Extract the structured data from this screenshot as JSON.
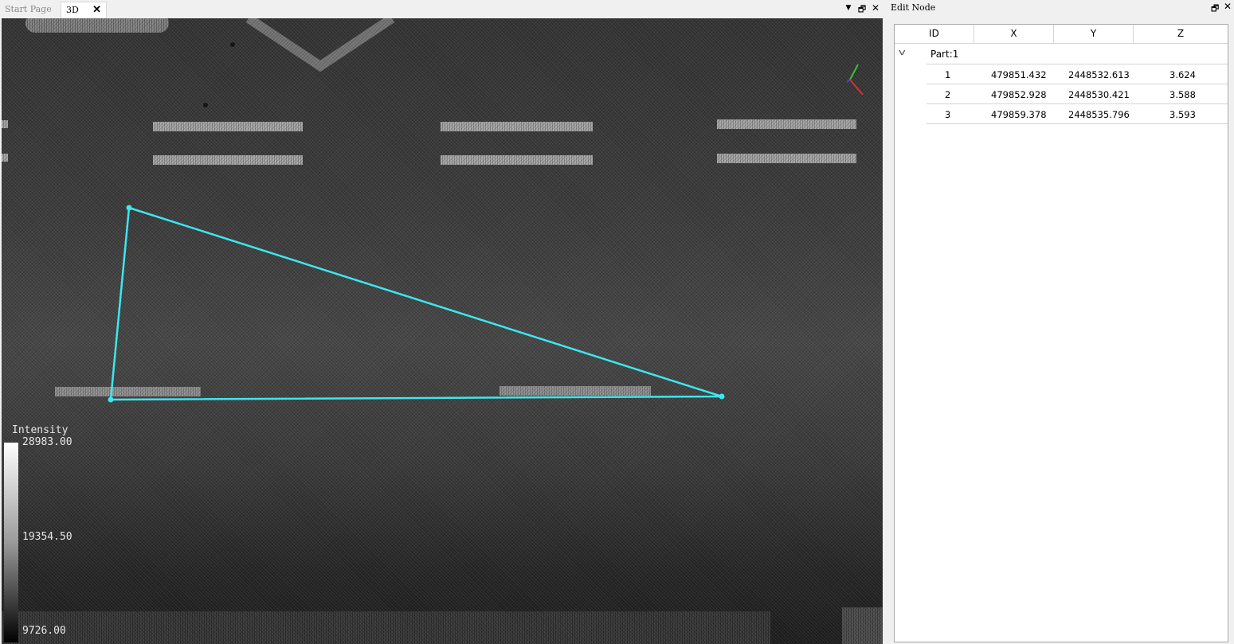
{
  "tabs": [
    {
      "label": "Start Page",
      "active": false
    },
    {
      "label": "3D",
      "active": true
    }
  ],
  "tab_close_glyph": "✕",
  "doc_controls": {
    "dropdown_icon": "chevron-down-icon",
    "restore_icon": "restore-icon",
    "close_icon": "close-icon"
  },
  "viewport": {
    "polygon_color": "#3ee6ee",
    "intensity_legend": {
      "title": "Intensity",
      "max": "28983.00",
      "mid": "19354.50",
      "min": "9726.00"
    }
  },
  "edit_node_panel": {
    "title": "Edit Node",
    "columns": [
      "ID",
      "X",
      "Y",
      "Z"
    ],
    "part_label": "Part:1",
    "rows": [
      {
        "id": "1",
        "x": "479851.432",
        "y": "2448532.613",
        "z": "3.624"
      },
      {
        "id": "2",
        "x": "479852.928",
        "y": "2448530.421",
        "z": "3.588"
      },
      {
        "id": "3",
        "x": "479859.378",
        "y": "2448535.796",
        "z": "3.593"
      }
    ]
  }
}
